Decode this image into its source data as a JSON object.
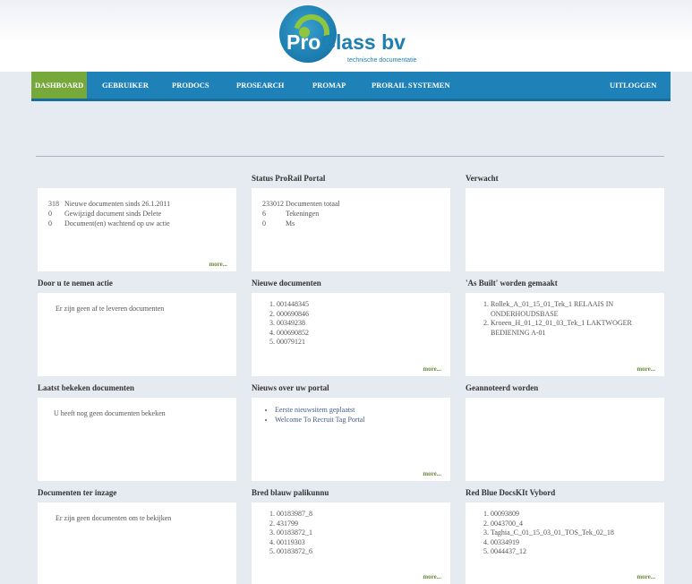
{
  "brand": {
    "name_pro": "Pro",
    "name_rest": "Class bv",
    "tagline": "technische documentatie"
  },
  "nav": {
    "items": [
      "DASHBOARD",
      "GEBRUIKER",
      "PRODOCS",
      "PROSEARCH",
      "PROMAP",
      "PRORAIL SYSTEMEN"
    ],
    "logout": "UITLOGGEN",
    "active": "DASHBOARD"
  },
  "more_label": "more...",
  "panels": {
    "p1": {
      "title": "",
      "rows": [
        {
          "num": "318",
          "text": "Nieuwe documenten sinds 26.1.2011"
        },
        {
          "num": "0",
          "text": "Gewijzigd document sinds Delete"
        },
        {
          "num": "0",
          "text": "Document(en) wachtend op uw actie"
        }
      ]
    },
    "p2": {
      "title": "Status ProRail Portal",
      "rows": [
        {
          "num": "233012",
          "text": "Documenten totaal"
        },
        {
          "num": "6",
          "text": "Tekeningen"
        },
        {
          "num": "0",
          "text": "Ms"
        }
      ]
    },
    "p3": {
      "title": "Verwacht"
    },
    "p4": {
      "title": "Door u te nemen actie",
      "text": "Er zijn geen af te leveren documenten"
    },
    "p5": {
      "title": "Nieuwe documenten",
      "items": [
        "001448345",
        "000690846",
        "00349238",
        "000690852",
        "00079121"
      ]
    },
    "p6": {
      "title": "'As Built' worden gemaakt",
      "items": [
        "Rollek_A_01_15_01_Tek_1 RELAAIS IN ONDERHOUDSBASE",
        "Kroeen_H_01_12_01_03_Tek_1 LAKTWOGER BEDIENING A-01"
      ]
    },
    "p7": {
      "title": "Laatst bekeken documenten",
      "text": "U heeft nog geen documenten bekeken"
    },
    "p8": {
      "title": "Nieuws over uw portal",
      "items": [
        "Eerste nieuwsitem geplaatst",
        "Welcome To Recruit Tag Portal"
      ]
    },
    "p9": {
      "title": "Geannoteerd worden"
    },
    "p10": {
      "title": "Documenten ter inzage",
      "text": "Er zijn geen documenten om te bekijken"
    },
    "p11": {
      "title": "Bred blauw palikunnu",
      "items": [
        "00183987_8",
        "431799",
        "00183872_1",
        "00119303",
        "00183872_6"
      ]
    },
    "p12": {
      "title": "Red Blue DocsKIt Vybord",
      "items": [
        "00093809",
        "0043700_4",
        "Taghia_C_01_15_03_01_TOS_Tek_02_18",
        "00334919",
        "0044437_12"
      ]
    }
  }
}
